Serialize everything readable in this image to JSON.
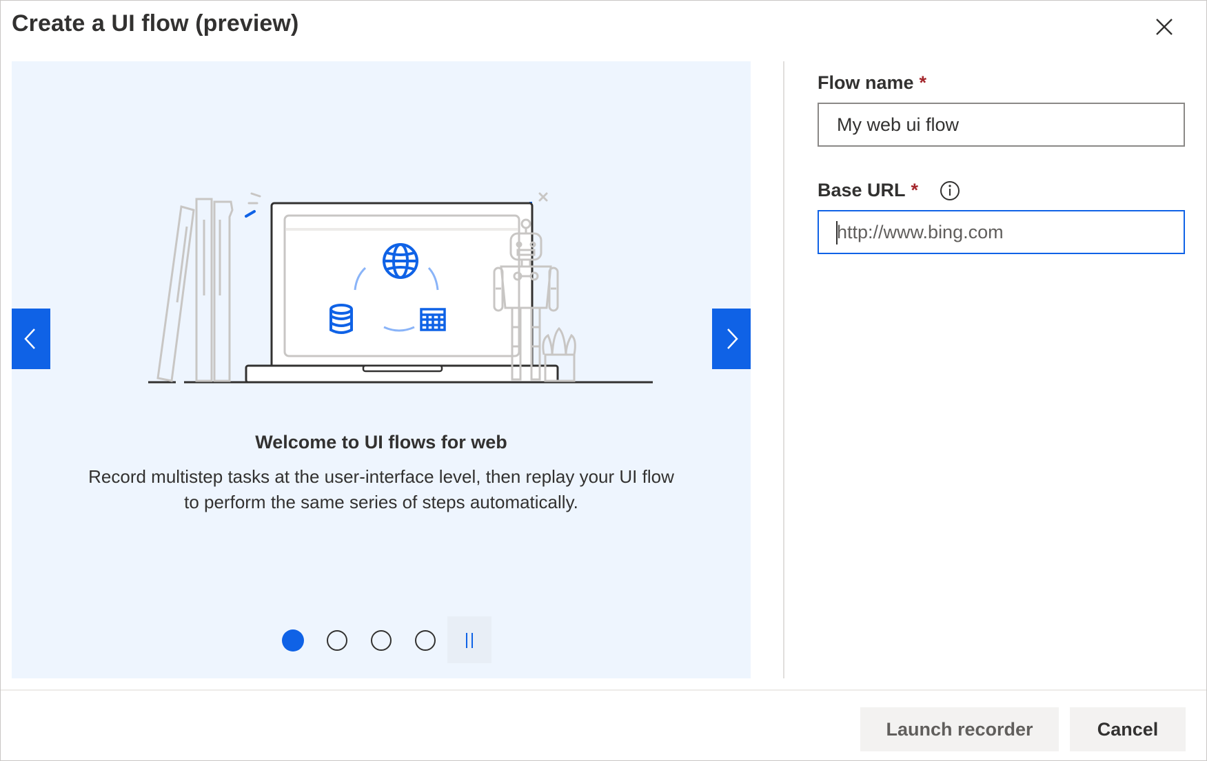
{
  "dialog": {
    "title": "Create a UI flow (preview)",
    "close_icon": "close-icon"
  },
  "carousel": {
    "slide_heading": "Welcome to UI flows for web",
    "slide_description": "Record multistep tasks at the user-interface level, then replay your UI flow to perform the same series of steps automatically.",
    "prev_icon": "chevron-left-icon",
    "next_icon": "chevron-right-icon",
    "pause_icon": "pause-icon",
    "dots": [
      {
        "active": true
      },
      {
        "active": false
      },
      {
        "active": false
      },
      {
        "active": false
      }
    ],
    "current_slide": 1,
    "slide_count": 4
  },
  "form": {
    "flow_name": {
      "label": "Flow name",
      "required_mark": "*",
      "value": "My web ui flow"
    },
    "base_url": {
      "label": "Base URL",
      "required_mark": "*",
      "info_icon": "info-icon",
      "placeholder": "http://www.bing.com",
      "value": ""
    }
  },
  "footer": {
    "launch_label": "Launch recorder",
    "cancel_label": "Cancel"
  },
  "colors": {
    "accent": "#0f62e6",
    "carousel_bg": "#eef5fe",
    "required": "#a4262c",
    "button_bg": "#f3f2f1"
  }
}
